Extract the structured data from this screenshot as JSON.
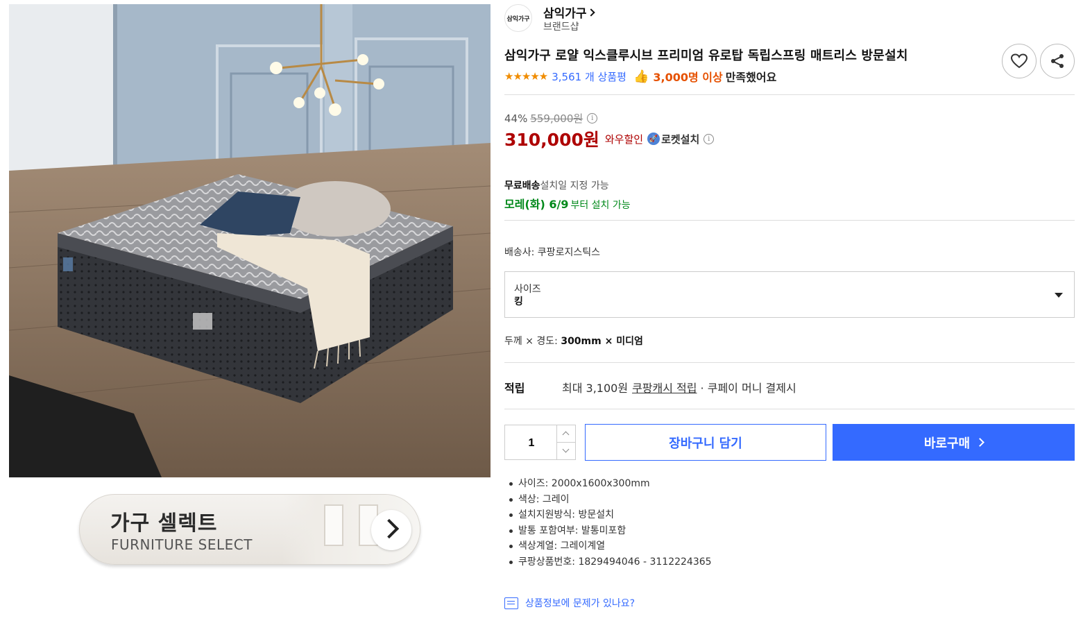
{
  "brand": {
    "logo_text": "삼익가구",
    "name": "삼익가구",
    "sub": "브랜드샵"
  },
  "product": {
    "title": "삼익가구 로얄 익스클루시브 프리미엄 유로탑 독립스프링 매트리스 방문설치",
    "rating_stars": "★★★★★",
    "rating_value": 5,
    "review_count": "3,561 개 상품평",
    "satisfied_count": "3,000명 이상",
    "satisfied_text": "만족했어요"
  },
  "price": {
    "discount_percent": "44%",
    "original": "559,000원",
    "sale": "310,000원",
    "wow_label": "와우할인",
    "rocket_label": "로켓설치"
  },
  "shipping": {
    "free_label": "무료배송",
    "date_note": "설치일 지정 가능",
    "date_bold": "모레(화) 6/9",
    "date_suffix": "부터 설치 가능",
    "carrier": "배송사:  쿠팡로지스틱스"
  },
  "option": {
    "label": "사이즈",
    "value": "킹"
  },
  "spec": {
    "label": "두께 × 경도: ",
    "value": "300mm × 미디엄"
  },
  "reward": {
    "label": "적립",
    "text": "최대 3,100원",
    "link": "쿠팡캐시 적립",
    "suffix": " · 쿠페이 머니 결제시"
  },
  "purchase": {
    "quantity": "1",
    "cart_label": "장바구니 담기",
    "buy_label": "바로구매"
  },
  "details": [
    "사이즈: 2000x1600x300mm",
    "색상: 그레이",
    "설치지원방식: 방문설치",
    "발통 포함여부: 발통미포함",
    "색상계열: 그레이계열",
    "쿠팡상품번호: 1829494046 - 3112224365"
  ],
  "report_link": "상품정보에 문제가 있나요?",
  "banner": {
    "title": "가구 셀렉트",
    "sub": "FURNITURE SELECT"
  },
  "icons": {
    "wishlist": "heart-icon",
    "share": "share-icon",
    "info": "info-icon",
    "rocket": "rocket-icon",
    "thumb": "thumbs-up-icon"
  },
  "colors": {
    "accent": "#346aff",
    "sale_price": "#ae0000",
    "star": "#f08c00",
    "satisfied": "#e65100",
    "delivery": "#00891a"
  }
}
